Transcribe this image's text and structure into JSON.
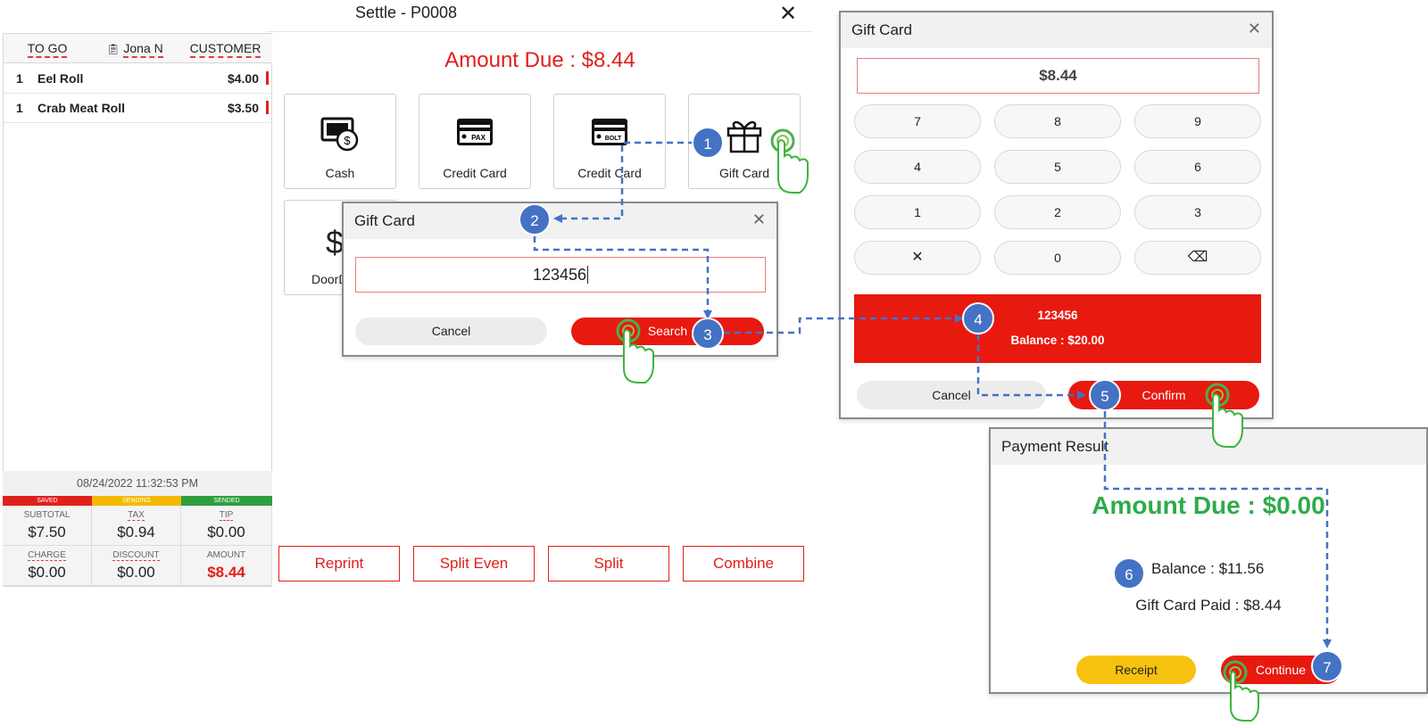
{
  "settle": {
    "title": "Settle - P0008",
    "close_glyph": "✕",
    "header": {
      "order_type": "TO GO",
      "server": "Jona N",
      "customer": "CUSTOMER"
    },
    "items": [
      {
        "qty": "1",
        "name": "Eel Roll",
        "price": "$4.00"
      },
      {
        "qty": "1",
        "name": "Crab Meat Roll",
        "price": "$3.50"
      }
    ],
    "timestamp": "08/24/2022 11:32:53 PM",
    "status": {
      "saved": "SAVED",
      "sending": "SENDING",
      "sended": "SENDED"
    },
    "summary": {
      "subtotal_label": "SUBTOTAL",
      "subtotal": "$7.50",
      "tax_label": "TAX",
      "tax": "$0.94",
      "tip_label": "TIP",
      "tip": "$0.00",
      "charge_label": "CHARGE",
      "charge": "$0.00",
      "discount_label": "DISCOUNT",
      "discount": "$0.00",
      "amount_label": "AMOUNT",
      "amount": "$8.44"
    },
    "amount_due": "Amount Due : $8.44",
    "payment_methods": [
      {
        "label": "Cash",
        "icon": "cash-icon"
      },
      {
        "label": "Credit Card",
        "icon": "pax-card-icon"
      },
      {
        "label": "Credit Card",
        "icon": "bolt-card-icon"
      },
      {
        "label": "Gift Card",
        "icon": "gift-icon"
      }
    ],
    "second_row_partial": "DoorD",
    "actions": {
      "reprint": "Reprint",
      "split_even": "Split Even",
      "split": "Split",
      "combine": "Combine"
    }
  },
  "gift_search_dialog": {
    "title": "Gift Card",
    "close_glyph": "✕",
    "input_value": "123456",
    "cancel": "Cancel",
    "search": "Search"
  },
  "gift_keypad_dialog": {
    "title": "Gift Card",
    "close_glyph": "✕",
    "amount": "$8.44",
    "keys": [
      "7",
      "8",
      "9",
      "4",
      "5",
      "6",
      "1",
      "2",
      "3",
      "✕",
      "0",
      "⌫"
    ],
    "card_number": "123456",
    "balance": "Balance : $20.00",
    "cancel": "Cancel",
    "confirm": "Confirm"
  },
  "payment_result_dialog": {
    "title": "Payment Result",
    "amount_due": "Amount Due : $0.00",
    "balance": "Balance : $11.56",
    "paid": "Gift Card Paid : $8.44",
    "receipt": "Receipt",
    "continue": "Continue"
  },
  "steps": [
    "1",
    "2",
    "3",
    "4",
    "5",
    "6",
    "7"
  ],
  "colors": {
    "accent_red": "#e0201b",
    "success_green": "#2eab4a",
    "step_blue": "#4472c4",
    "saved": "#e0201b",
    "sending": "#f5b800",
    "sended": "#2e9f3c",
    "receipt_yellow": "#f7c20f"
  }
}
